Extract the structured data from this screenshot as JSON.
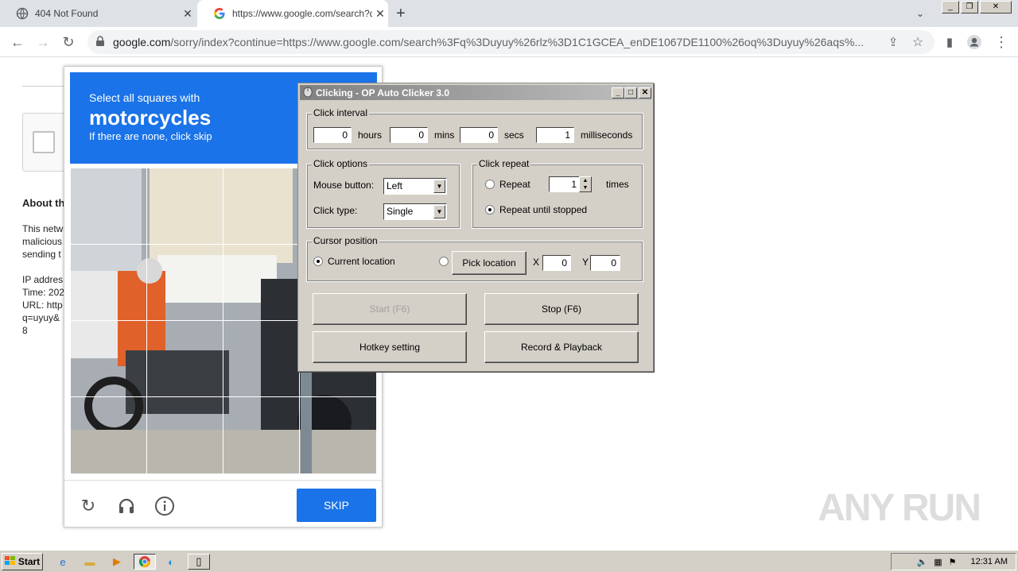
{
  "browser": {
    "tabs": [
      {
        "title": "404 Not Found"
      },
      {
        "title": "https://www.google.com/search?q="
      }
    ],
    "new_tab": "+",
    "url_host": "google.com",
    "url_rest": "/sorry/index?continue=https://www.google.com/search%3Fq%3Duyuy%26rlz%3D1C1GCEA_enDE1067DE1100%26oq%3Duyuy%26aqs%..."
  },
  "page": {
    "about_title": "About th",
    "para_lines": [
      "This netw",
      "malicious",
      "sending t"
    ],
    "ip_lines": [
      "IP addres",
      "Time: 202",
      "URL: http",
      "q=uyuy&",
      "8"
    ]
  },
  "recaptcha": {
    "line1": "Select all squares with",
    "keyword": "motorcycles",
    "line3": "If there are none, click skip",
    "skip_label": "SKIP"
  },
  "clicker": {
    "title": "Clicking - OP Auto Clicker 3.0",
    "interval_label": "Click interval",
    "hours_value": "0",
    "hours_label": "hours",
    "mins_value": "0",
    "mins_label": "mins",
    "secs_value": "0",
    "secs_label": "secs",
    "ms_value": "1",
    "ms_label": "milliseconds",
    "options_label": "Click options",
    "mouse_button_label": "Mouse button:",
    "mouse_button_value": "Left",
    "click_type_label": "Click type:",
    "click_type_value": "Single",
    "repeat_label": "Click repeat",
    "repeat_radio": "Repeat",
    "repeat_value": "1",
    "times_label": "times",
    "repeat_until_label": "Repeat until stopped",
    "cursor_label": "Cursor position",
    "current_location_label": "Current location",
    "pick_location_label": "Pick location",
    "x_label": "X",
    "x_value": "0",
    "y_label": "Y",
    "y_value": "0",
    "start_label": "Start (F6)",
    "stop_label": "Stop (F6)",
    "hotkey_label": "Hotkey setting",
    "record_label": "Record & Playback"
  },
  "taskbar": {
    "start_label": "Start",
    "clock": "12:31 AM"
  },
  "watermark": "ANY RUN"
}
